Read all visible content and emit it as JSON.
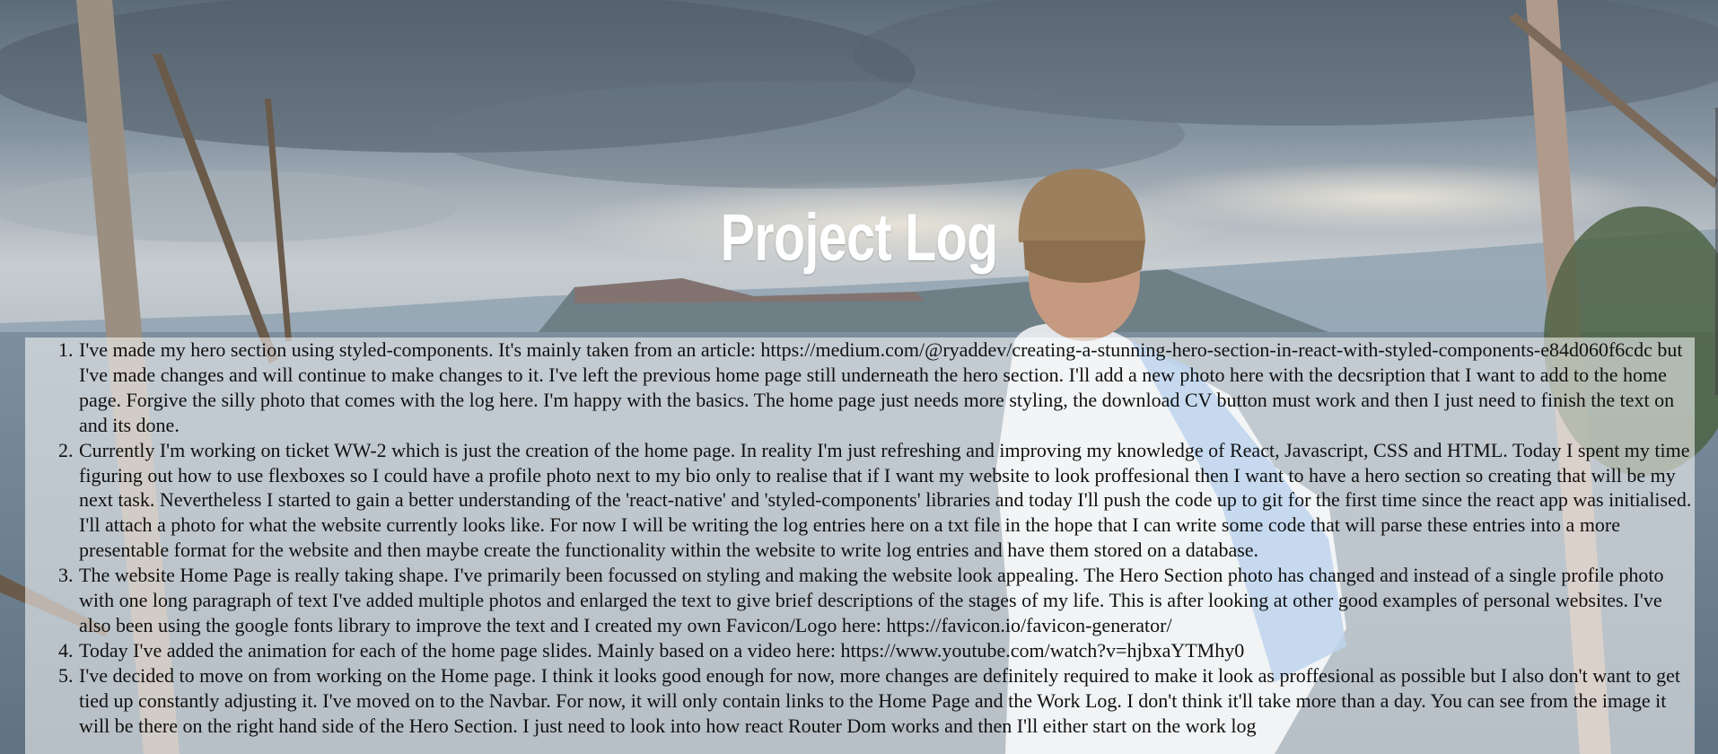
{
  "page": {
    "title": "Project Log",
    "background_image": "hiker with cap and backpack overlooking a mountain valley"
  },
  "log": {
    "entries": [
      "I've made my hero section using styled-components. It's mainly taken from an article: https://medium.com/@ryaddev/creating-a-stunning-hero-section-in-react-with-styled-components-e84d060f6cdc but I've made changes and will continue to make changes to it. I've left the previous home page still underneath the hero section. I'll add a new photo here with the decsription that I want to add to the home page. Forgive the silly photo that comes with the log here. I'm happy with the basics. The home page just needs more styling, the download CV button must work and then I just need to finish the text on and its done.",
      "Currently I'm working on ticket WW-2 which is just the creation of the home page. In reality I'm just refreshing and improving my knowledge of React, Javascript, CSS and HTML. Today I spent my time figuring out how to use flexboxes so I could have a profile photo next to my bio only to realise that if I want my website to look proffesional then I want to have a hero section so creating that will be my next task. Nevertheless I started to gain a better understanding of the 'react-native' and 'styled-components' libraries and today I'll push the code up to git for the first time since the react app was initialised. I'll attach a photo for what the website currently looks like. For now I will be writing the log entries here on a txt file in the hope that I can write some code that will parse these entries into a more presentable format for the website and then maybe create the functionality within the website to write log entries and have them stored on a database.",
      "The website Home Page is really taking shape. I've primarily been focussed on styling and making the website look appealing. The Hero Section photo has changed and instead of a single profile photo with one long paragraph of text I've added multiple photos and enlarged the text to give brief descriptions of the stages of my life. This is after looking at other good examples of personal websites. I've also been using the google fonts library to improve the text and I created my own Favicon/Logo here: https://favicon.io/favicon-generator/",
      "Today I've added the animation for each of the home page slides. Mainly based on a video here: https://www.youtube.com/watch?v=hjbxaYTMhy0",
      "I've decided to move on from working on the Home page. I think it looks good enough for now, more changes are definitely required to make it look as proffesional as possible but I also don't want to get tied up constantly adjusting it. I've moved on to the Navbar. For now, it will only contain links to the Home Page and the Work Log. I don't think it'll take more than a day. You can see from the image it will be there on the right hand side of the Hero Section. I just need to look into how react Router Dom works and then I'll either start on the work log"
    ]
  },
  "colors": {
    "title": "#ffffff",
    "panel_overlay": "rgba(255,255,255,0.55)",
    "text": "#111111"
  }
}
